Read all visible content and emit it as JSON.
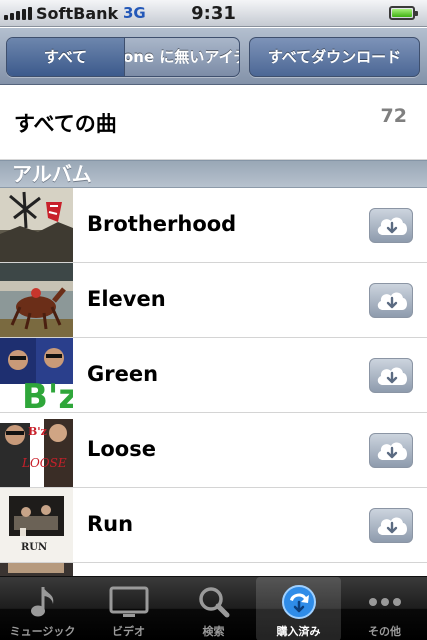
{
  "status_bar": {
    "carrier": "SoftBank",
    "network": "3G",
    "time": "9:31",
    "battery_level": 1.0
  },
  "toolbar": {
    "segments": [
      {
        "label": "すべて",
        "selected": true
      },
      {
        "label": "one に無いアイテ",
        "selected": false
      }
    ],
    "download_all_label": "すべてダウンロード"
  },
  "all_songs": {
    "label": "すべての曲",
    "count": "72"
  },
  "section_header": "アルバム",
  "albums": [
    {
      "title": "Brotherhood",
      "art": "brotherhood-cover"
    },
    {
      "title": "Eleven",
      "art": "eleven-cover"
    },
    {
      "title": "Green",
      "art": "green-cover"
    },
    {
      "title": "Loose",
      "art": "loose-cover"
    },
    {
      "title": "Run",
      "art": "run-cover"
    }
  ],
  "download_icon": "cloud-download-icon",
  "tabs": [
    {
      "label": "ミュージック",
      "icon": "music-note-icon",
      "active": false
    },
    {
      "label": "ビデオ",
      "icon": "tv-icon",
      "active": false
    },
    {
      "label": "検索",
      "icon": "search-icon",
      "active": false
    },
    {
      "label": "購入済み",
      "icon": "purchased-download-icon",
      "active": true
    },
    {
      "label": "その他",
      "icon": "more-icon",
      "active": false
    }
  ],
  "colors": {
    "toolbar": "#8f9db3",
    "selected_segment": "#4b6898",
    "section_header": "#a7b3c1",
    "tab_bar": "#000000",
    "active_tab_icon": "#2f8ce8"
  }
}
